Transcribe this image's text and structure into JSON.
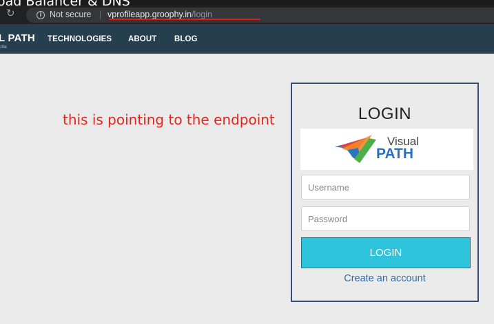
{
  "window": {
    "title": "oad Balancer & DNS"
  },
  "browser": {
    "security_label": "Not secure",
    "separator": "|",
    "url_host": "vprofileapp.groophy.in",
    "url_path": "/login",
    "reload_icon": "reload-icon",
    "info_icon": "info-icon",
    "info_glyph": "i",
    "reload_glyph": "↻"
  },
  "navbar": {
    "brand": "L PATH",
    "brand_subtitle": "ofile",
    "items": [
      {
        "label": "TECHNOLOGIES"
      },
      {
        "label": "ABOUT"
      },
      {
        "label": "BLOG"
      }
    ]
  },
  "annotation": {
    "text": "this is pointing to the endpoint",
    "color": "#e5251b"
  },
  "login": {
    "title": "LOGIN",
    "logo": {
      "line1": "Visual",
      "line2": "PATH"
    },
    "username_placeholder": "Username",
    "password_placeholder": "Password",
    "button_label": "LOGIN",
    "create_account_link": "Create an account"
  },
  "colors": {
    "navbar": "#253f4f",
    "button": "#2ec4dc",
    "panel_border": "#354f73",
    "link": "#346a9a"
  }
}
